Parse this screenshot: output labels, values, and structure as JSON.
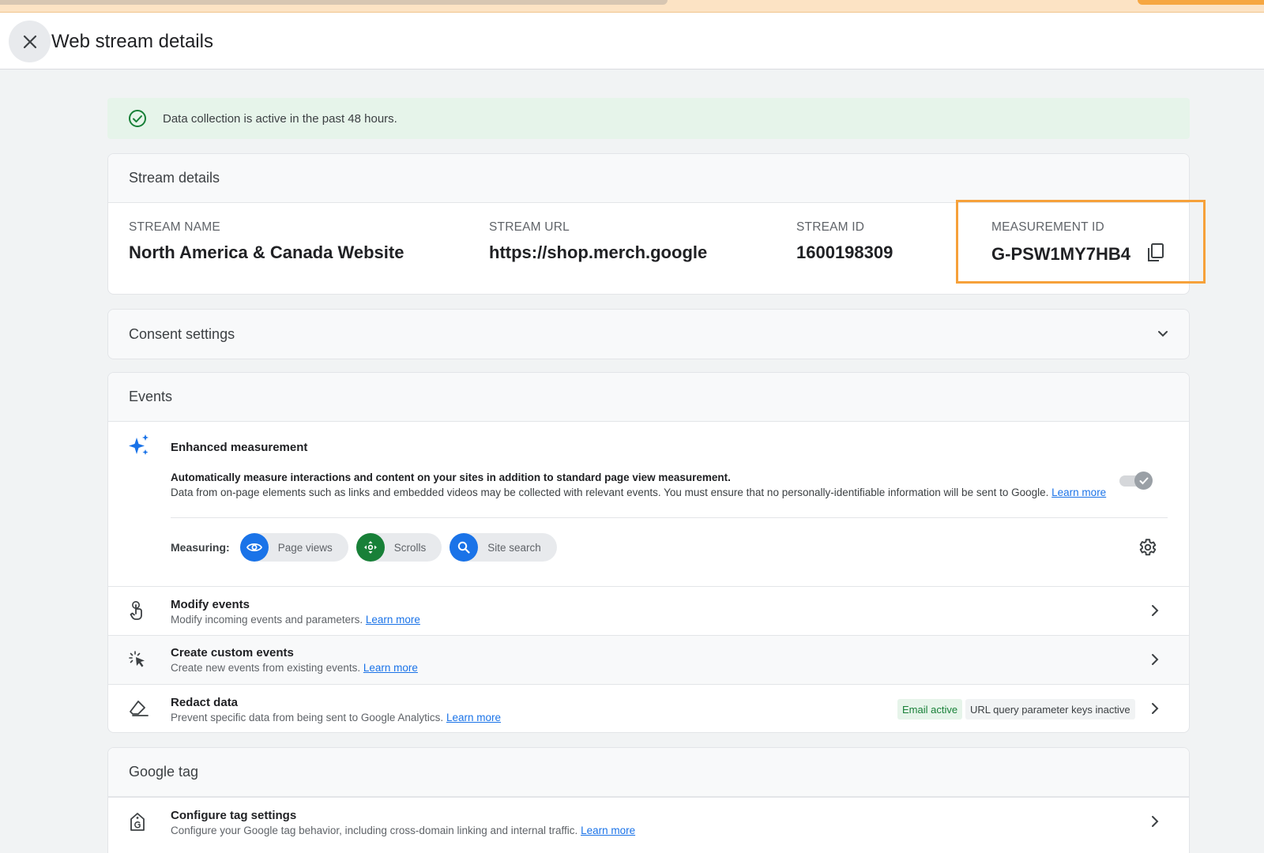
{
  "header": {
    "title": "Web stream details"
  },
  "banner": {
    "text": "Data collection is active in the past 48 hours."
  },
  "stream_details": {
    "heading": "Stream details",
    "columns": [
      {
        "label": "STREAM NAME",
        "value": "North America & Canada Website"
      },
      {
        "label": "STREAM URL",
        "value": "https://shop.merch.google"
      },
      {
        "label": "STREAM ID",
        "value": "1600198309"
      },
      {
        "label": "MEASUREMENT ID",
        "value": "G-PSW1MY7HB4"
      }
    ]
  },
  "consent": {
    "heading": "Consent settings"
  },
  "events": {
    "heading": "Events",
    "enhanced": {
      "title": "Enhanced measurement",
      "strong": "Automatically measure interactions and content on your sites in addition to standard page view measurement.",
      "desc": "Data from on-page elements such as links and embedded videos may be collected with relevant events. You must ensure that no personally-identifiable information will be sent to Google.",
      "link": "Learn more",
      "measuring_label": "Measuring:",
      "chips": [
        {
          "label": "Page views",
          "icon": "eye-icon",
          "color": "#1a73e8"
        },
        {
          "label": "Scrolls",
          "icon": "scroll-icon",
          "color": "#188038"
        },
        {
          "label": "Site search",
          "icon": "search-icon",
          "color": "#1a73e8"
        }
      ]
    },
    "rows": [
      {
        "title": "Modify events",
        "desc": "Modify incoming events and parameters.",
        "link": "Learn more"
      },
      {
        "title": "Create custom events",
        "desc": "Create new events from existing events.",
        "link": "Learn more"
      },
      {
        "title": "Redact data",
        "desc": "Prevent specific data from being sent to Google Analytics.",
        "link": "Learn more",
        "badges": {
          "email": "Email active",
          "url": "URL query parameter keys inactive"
        }
      }
    ]
  },
  "google_tag": {
    "heading": "Google tag",
    "rows": [
      {
        "title": "Configure tag settings",
        "desc": "Configure your Google tag behavior, including cross-domain linking and internal traffic.",
        "link": "Learn more"
      }
    ]
  },
  "colors": {
    "accent": "#1a73e8",
    "success": "#188038",
    "highlight": "#f6a13a"
  }
}
